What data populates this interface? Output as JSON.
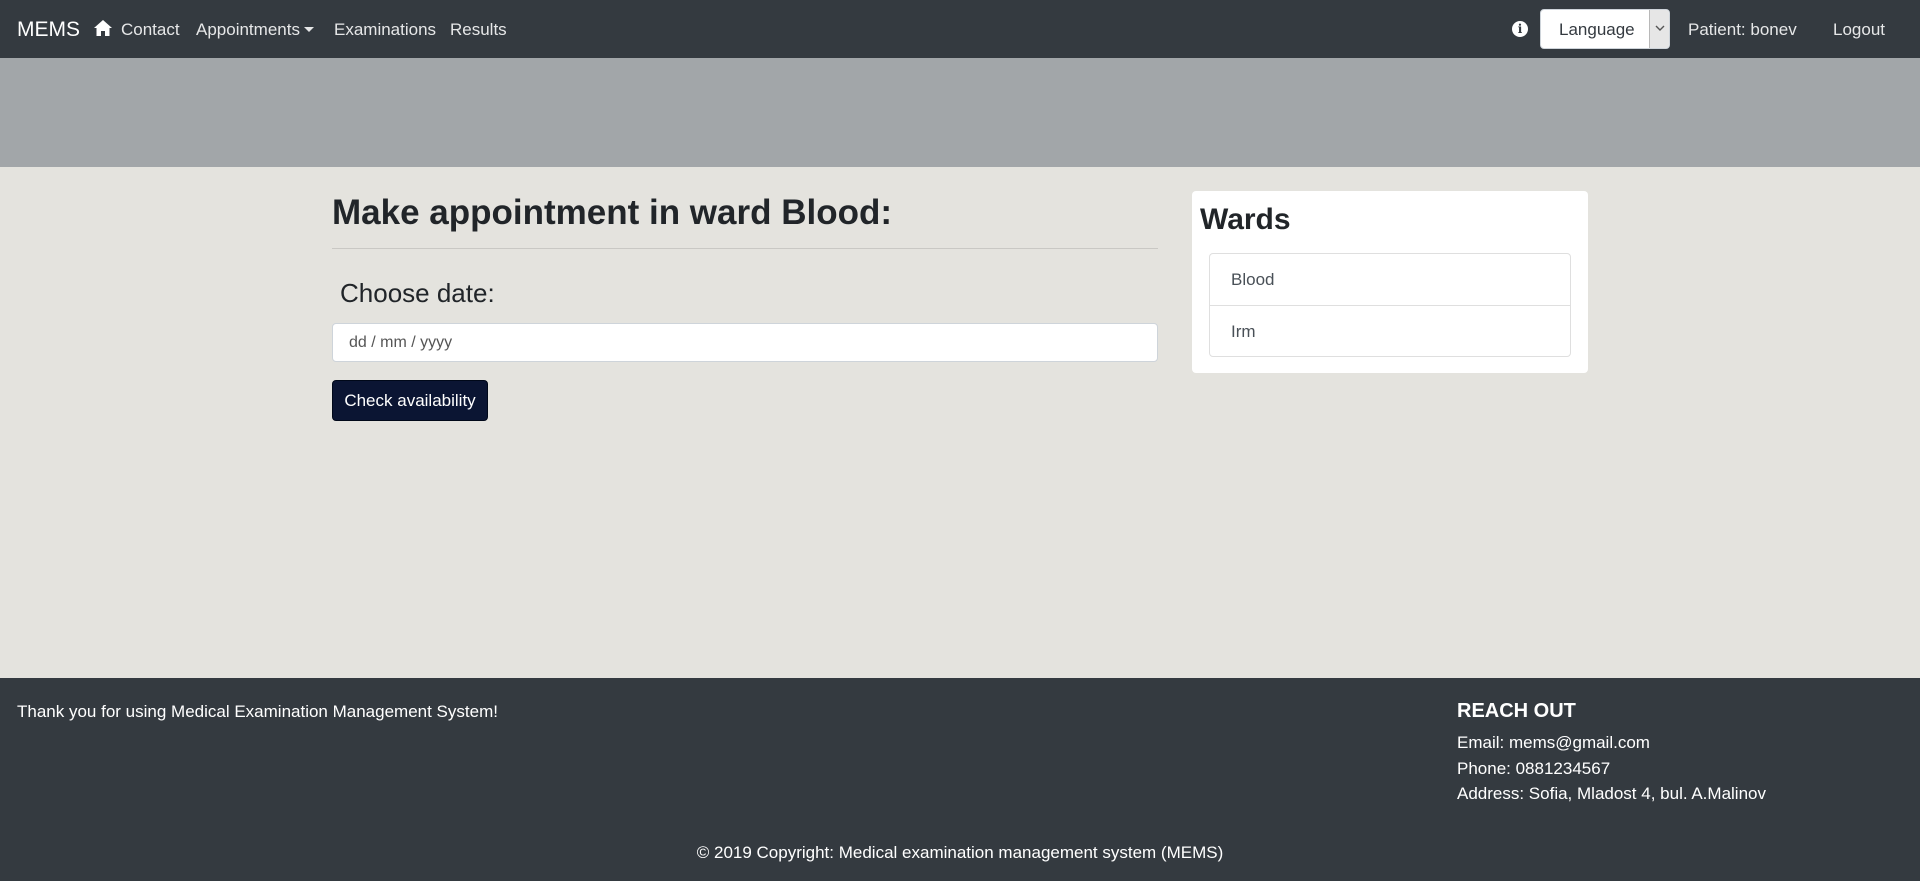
{
  "navbar": {
    "brand": "MEMS",
    "home_icon": "home-icon",
    "links": {
      "contact": "Contact",
      "appointments": "Appointments",
      "examinations": "Examinations",
      "results": "Results"
    },
    "info_icon": "info-icon",
    "language_select": "Language",
    "patient": "Patient: bonev",
    "logout": "Logout"
  },
  "main": {
    "title": "Make appointment in ward Blood:",
    "choose_date_label": "Choose date:",
    "date_placeholder": "dd / mm / yyyy",
    "check_button": "Check availability"
  },
  "wards": {
    "title": "Wards",
    "items": [
      {
        "label": "Blood"
      },
      {
        "label": "Irm"
      }
    ]
  },
  "footer": {
    "thanks": "Thank you for using Medical Examination Management System!",
    "reach_title": "REACH OUT",
    "email": "Email: mems@gmail.com",
    "phone": "Phone: 0881234567",
    "address": "Address: Sofia, Mladost 4, bul. A.Malinov",
    "copyright": "© 2019 Copyright: Medical examination management system (MEMS)"
  },
  "colors": {
    "navbar_bg": "#343a40",
    "hero_bg": "#a2a6a9",
    "page_bg": "#e4e3de",
    "button_bg": "#0b1533"
  }
}
